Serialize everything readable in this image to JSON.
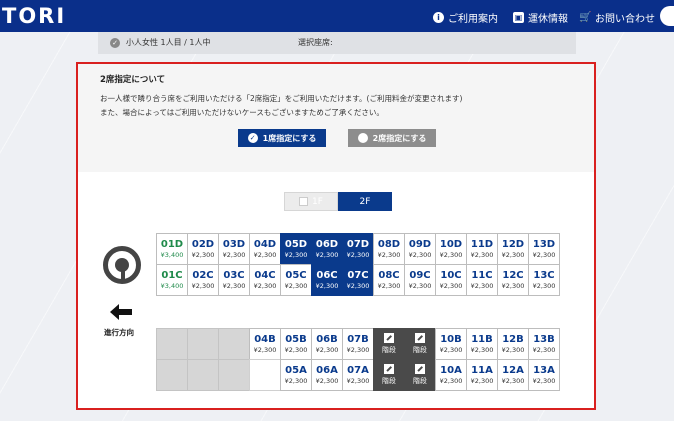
{
  "header": {
    "logo": "TORI",
    "nav": [
      {
        "label": "ご利用案内",
        "icon": "info-icon"
      },
      {
        "label": "運休情報",
        "icon": "bus-icon"
      },
      {
        "label": "お問い合わせ",
        "icon": "cart-icon"
      }
    ]
  },
  "passenger_strip": {
    "passenger": "小人女性 1人目 / 1人中",
    "selected_label": "選択座席:"
  },
  "notice": {
    "title": "2席指定について",
    "line1": "お一人様で隣り合う席をご利用いただける「2席指定」をご利用いただけます。(ご利用料金が変更されます)",
    "line2": "また、場合によってはご利用いただけないケースもございますためご了承ください。",
    "option_single": "1席指定にする",
    "option_double": "2席指定にする"
  },
  "floor_tabs": {
    "f1": "1F",
    "f2": "2F"
  },
  "direction_label": "進行方向",
  "seat_rows": {
    "row_d": [
      {
        "code": "01D",
        "price": "¥3,400",
        "state": "green"
      },
      {
        "code": "02D",
        "price": "¥2,300",
        "state": "free"
      },
      {
        "code": "03D",
        "price": "¥2,300",
        "state": "free"
      },
      {
        "code": "04D",
        "price": "¥2,300",
        "state": "free"
      },
      {
        "code": "05D",
        "price": "¥2,300",
        "state": "taken"
      },
      {
        "code": "06D",
        "price": "¥2,300",
        "state": "taken"
      },
      {
        "code": "07D",
        "price": "¥2,300",
        "state": "taken"
      },
      {
        "code": "08D",
        "price": "¥2,300",
        "state": "free"
      },
      {
        "code": "09D",
        "price": "¥2,300",
        "state": "free"
      },
      {
        "code": "10D",
        "price": "¥2,300",
        "state": "free"
      },
      {
        "code": "11D",
        "price": "¥2,300",
        "state": "free"
      },
      {
        "code": "12D",
        "price": "¥2,300",
        "state": "free"
      },
      {
        "code": "13D",
        "price": "¥2,300",
        "state": "free"
      }
    ],
    "row_c": [
      {
        "code": "01C",
        "price": "¥3,400",
        "state": "green"
      },
      {
        "code": "02C",
        "price": "¥2,300",
        "state": "free"
      },
      {
        "code": "03C",
        "price": "¥2,300",
        "state": "free"
      },
      {
        "code": "04C",
        "price": "¥2,300",
        "state": "free"
      },
      {
        "code": "05C",
        "price": "¥2,300",
        "state": "free"
      },
      {
        "code": "06C",
        "price": "¥2,300",
        "state": "taken"
      },
      {
        "code": "07C",
        "price": "¥2,300",
        "state": "taken"
      },
      {
        "code": "08C",
        "price": "¥2,300",
        "state": "free"
      },
      {
        "code": "09C",
        "price": "¥2,300",
        "state": "free"
      },
      {
        "code": "10C",
        "price": "¥2,300",
        "state": "free"
      },
      {
        "code": "11C",
        "price": "¥2,300",
        "state": "free"
      },
      {
        "code": "12C",
        "price": "¥2,300",
        "state": "free"
      },
      {
        "code": "13C",
        "price": "¥2,300",
        "state": "free"
      }
    ],
    "row_b": [
      {
        "state": "empty"
      },
      {
        "state": "empty"
      },
      {
        "state": "empty"
      },
      {
        "code": "04B",
        "price": "¥2,300",
        "state": "free"
      },
      {
        "code": "05B",
        "price": "¥2,300",
        "state": "free"
      },
      {
        "code": "06B",
        "price": "¥2,300",
        "state": "free"
      },
      {
        "code": "07B",
        "price": "¥2,300",
        "state": "free"
      },
      {
        "label": "階段",
        "state": "stairs"
      },
      {
        "label": "階段",
        "state": "stairs"
      },
      {
        "code": "10B",
        "price": "¥2,300",
        "state": "free"
      },
      {
        "code": "11B",
        "price": "¥2,300",
        "state": "free"
      },
      {
        "code": "12B",
        "price": "¥2,300",
        "state": "free"
      },
      {
        "code": "13B",
        "price": "¥2,300",
        "state": "free"
      }
    ],
    "row_a": [
      {
        "state": "empty"
      },
      {
        "state": "empty"
      },
      {
        "state": "empty"
      },
      {
        "state": "blank"
      },
      {
        "code": "05A",
        "price": "¥2,300",
        "state": "free"
      },
      {
        "code": "06A",
        "price": "¥2,300",
        "state": "free"
      },
      {
        "code": "07A",
        "price": "¥2,300",
        "state": "free"
      },
      {
        "label": "階段",
        "state": "stairs"
      },
      {
        "label": "階段",
        "state": "stairs"
      },
      {
        "code": "10A",
        "price": "¥2,300",
        "state": "free"
      },
      {
        "code": "11A",
        "price": "¥2,300",
        "state": "free"
      },
      {
        "code": "12A",
        "price": "¥2,300",
        "state": "free"
      },
      {
        "code": "13A",
        "price": "¥2,300",
        "state": "free"
      }
    ]
  }
}
